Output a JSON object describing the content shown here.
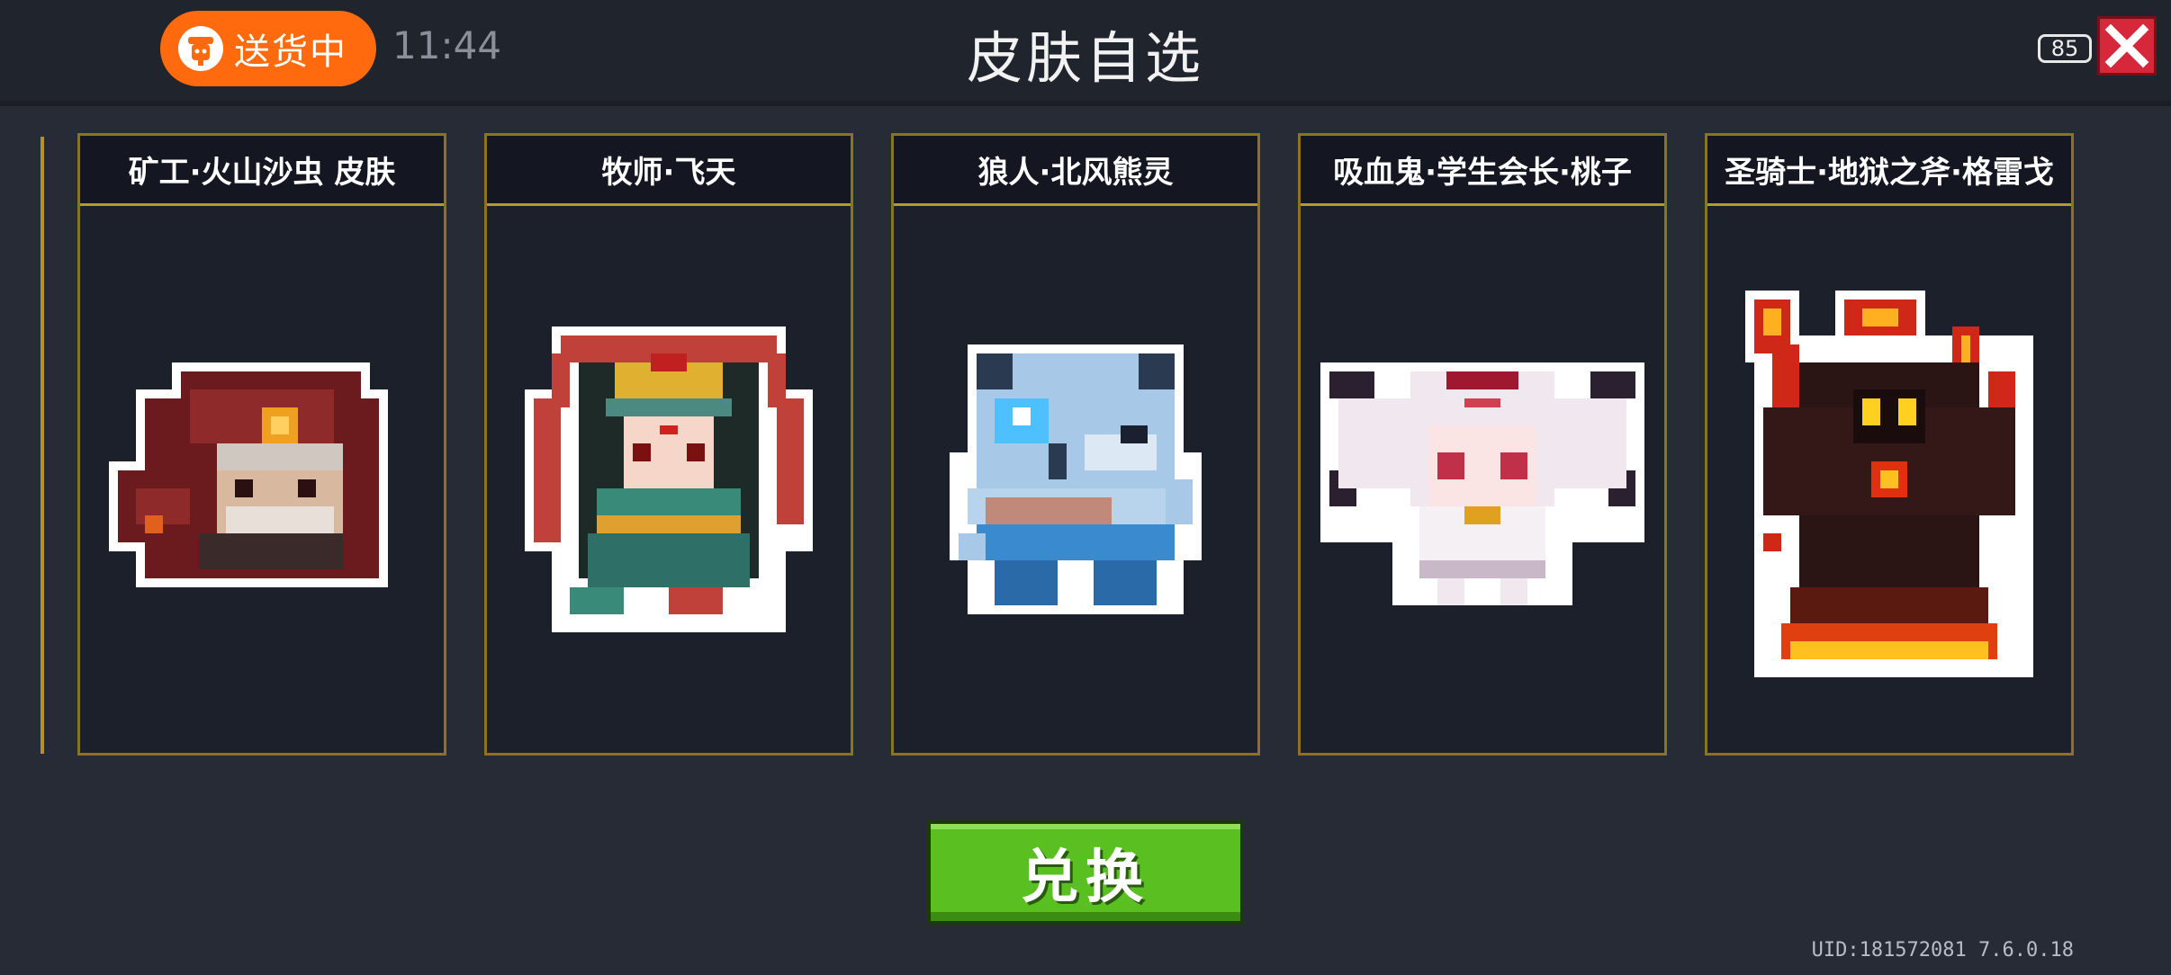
{
  "status_bar": {
    "delivery_label": "送货中",
    "time": "11:44",
    "battery": "85"
  },
  "header": {
    "title": "皮肤自选"
  },
  "skins": [
    {
      "name": "矿工·火山沙虫 皮肤",
      "icon": "volcano-sandworm-miner-sprite"
    },
    {
      "name": "牧师·飞天",
      "icon": "feitian-priest-sprite"
    },
    {
      "name": "狼人·北风熊灵",
      "icon": "north-wind-bear-werewolf-sprite"
    },
    {
      "name": "吸血鬼·学生会长·桃子",
      "icon": "student-president-vampire-sprite"
    },
    {
      "name": "圣骑士·地狱之斧·格雷戈",
      "icon": "hell-axe-paladin-sprite"
    }
  ],
  "footer": {
    "exchange_label": "兑换",
    "uid": "UID:181572081 7.6.0.18"
  },
  "colors": {
    "background": "#262b36",
    "accent_orange": "#ff6a0e",
    "card_border": "#b59a2c",
    "close_red": "#d6283a",
    "button_green": "#5ac021"
  }
}
